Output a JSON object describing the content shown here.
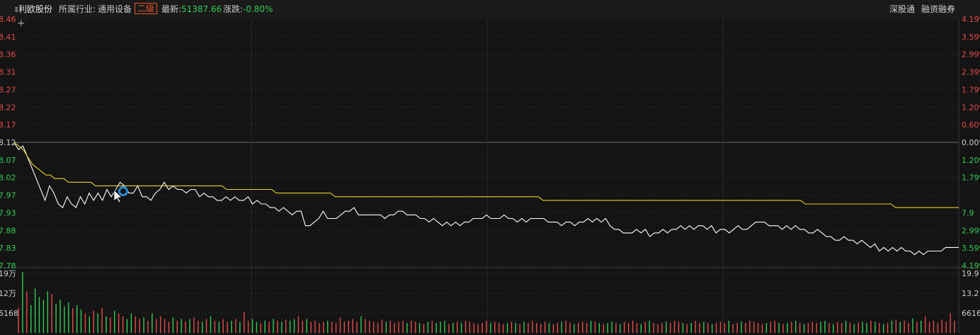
{
  "header": {
    "stock_name": "利欧股份",
    "industry_label": "所属行业:",
    "industry_value": "通用设备",
    "level_badge": "二级",
    "latest_label": "最新:",
    "latest_value": "51387.66",
    "change_label": "涨跌:",
    "change_value": "-0.80%",
    "link_shenguton": "深股通",
    "link_margin": "融资融券"
  },
  "colors": {
    "background": "#141414",
    "up": "#e84a4a",
    "down": "#33cc55",
    "price_line": "#ffffff",
    "avg_line": "#e6d22a",
    "grid": "#2e2e2e"
  },
  "chart_data": [
    {
      "type": "line",
      "prev_close": 8.12,
      "ylim": [
        7.78,
        8.46
      ],
      "y_tick_labels_left": [
        "8.46",
        "8.41",
        "8.36",
        "8.31",
        "8.27",
        "8.22",
        "8.17",
        "8.12",
        "8.07",
        "8.02",
        "7.97",
        "7.93",
        "7.88",
        "7.83",
        "7.78"
      ],
      "y_tick_labels_right": [
        "4.19%",
        "3.59%",
        "2.99%",
        "2.39%",
        "1.79%",
        "1.20%",
        "0.60%",
        "0.00%",
        "1.20%",
        "1.79%",
        "7.9",
        "2.99%",
        "3.59%",
        "4.19%"
      ],
      "series": [
        {
          "values": [
            8.12,
            8.1,
            8.11,
            8.08,
            8.05,
            8.02,
            7.99,
            7.96,
            8.0,
            7.98,
            7.95,
            7.94,
            7.97,
            7.95,
            7.94,
            7.97,
            7.95,
            7.98,
            7.96,
            7.98,
            7.96,
            7.99,
            7.97,
            7.99,
            8.01,
            8.0,
            7.98,
            7.98,
            8.0,
            7.97,
            7.97,
            7.96,
            7.98,
            7.99,
            8.01,
            7.99,
            8.0,
            7.99,
            7.99,
            7.98,
            7.99,
            7.99,
            7.97,
            7.98,
            7.97,
            7.97,
            7.96,
            7.96,
            7.97,
            7.96,
            7.97,
            7.96,
            7.96,
            7.97,
            7.95,
            7.96,
            7.95,
            7.95,
            7.94,
            7.94,
            7.93,
            7.94,
            7.93,
            7.92,
            7.93,
            7.93,
            7.89,
            7.89,
            7.9,
            7.91,
            7.93,
            7.91,
            7.91,
            7.91,
            7.92,
            7.93,
            7.93,
            7.94,
            7.92,
            7.92,
            7.92,
            7.92,
            7.92,
            7.92,
            7.91,
            7.92,
            7.92,
            7.93,
            7.93,
            7.92,
            7.92,
            7.92,
            7.91,
            7.91,
            7.9,
            7.91,
            7.9,
            7.89,
            7.9,
            7.89,
            7.9,
            7.89,
            7.9,
            7.9,
            7.91,
            7.91,
            7.91,
            7.92,
            7.91,
            7.91,
            7.91,
            7.92,
            7.91,
            7.91,
            7.9,
            7.91,
            7.9,
            7.91,
            7.91,
            7.91,
            7.91,
            7.9,
            7.9,
            7.9,
            7.89,
            7.9,
            7.9,
            7.89,
            7.9,
            7.9,
            7.91,
            7.9,
            7.91,
            7.9,
            7.91,
            7.89,
            7.88,
            7.88,
            7.87,
            7.87,
            7.87,
            7.88,
            7.87,
            7.88,
            7.86,
            7.87,
            7.87,
            7.88,
            7.87,
            7.88,
            7.88,
            7.89,
            7.88,
            7.89,
            7.88,
            7.89,
            7.89,
            7.88,
            7.89,
            7.87,
            7.88,
            7.88,
            7.87,
            7.88,
            7.89,
            7.88,
            7.88,
            7.89,
            7.9,
            7.9,
            7.9,
            7.89,
            7.89,
            7.89,
            7.88,
            7.89,
            7.88,
            7.89,
            7.88,
            7.88,
            7.87,
            7.87,
            7.88,
            7.87,
            7.86,
            7.86,
            7.85,
            7.85,
            7.86,
            7.85,
            7.85,
            7.84,
            7.85,
            7.84,
            7.83,
            7.84,
            7.82,
            7.83,
            7.82,
            7.83,
            7.82,
            7.83,
            7.82,
            7.82,
            7.81,
            7.82,
            7.81,
            7.82,
            7.82,
            7.82,
            7.82,
            7.83,
            7.83,
            7.83,
            7.83
          ]
        },
        {
          "values": [
            8.12,
            8.11,
            8.1,
            8.08,
            8.06,
            8.05,
            8.04,
            8.03,
            8.03,
            8.02,
            8.02,
            8.02,
            8.01,
            8.01,
            8.01,
            8.01,
            8.01,
            8.01,
            8.0,
            8.0,
            8.0,
            8.0,
            8.0,
            8.0,
            8.0,
            8.0,
            8.0,
            8.0,
            8.0,
            8.0,
            8.0,
            8.0,
            8.0,
            8.0,
            8.0,
            8.0,
            8.0,
            8.0,
            8.0,
            8.0,
            8.0,
            8.0,
            8.0,
            8.0,
            8.0,
            8.0,
            8.0,
            7.99,
            7.99,
            7.99,
            7.99,
            7.99,
            7.99,
            7.99,
            7.99,
            7.99,
            7.99,
            7.99,
            7.98,
            7.98,
            7.98,
            7.98,
            7.98,
            7.98,
            7.98,
            7.98,
            7.98,
            7.98,
            7.98,
            7.98,
            7.98,
            7.97,
            7.97,
            7.97,
            7.97,
            7.97,
            7.97,
            7.97,
            7.97,
            7.97,
            7.97,
            7.97,
            7.97,
            7.97,
            7.97,
            7.97,
            7.97,
            7.97,
            7.97,
            7.97,
            7.97,
            7.97,
            7.97,
            7.97,
            7.97,
            7.97,
            7.97,
            7.97,
            7.97,
            7.97,
            7.97,
            7.97,
            7.97,
            7.97,
            7.97,
            7.97,
            7.97,
            7.97,
            7.97,
            7.97,
            7.97,
            7.97,
            7.97,
            7.97,
            7.97,
            7.97,
            7.97,
            7.96,
            7.96,
            7.96,
            7.96,
            7.96,
            7.96,
            7.96,
            7.96,
            7.96,
            7.96,
            7.96,
            7.96,
            7.96,
            7.96,
            7.96,
            7.96,
            7.96,
            7.96,
            7.96,
            7.96,
            7.96,
            7.96,
            7.96,
            7.96,
            7.96,
            7.96,
            7.96,
            7.96,
            7.96,
            7.96,
            7.96,
            7.96,
            7.96,
            7.96,
            7.96,
            7.96,
            7.96,
            7.96,
            7.96,
            7.96,
            7.96,
            7.96,
            7.96,
            7.96,
            7.96,
            7.96,
            7.96,
            7.96,
            7.96,
            7.96,
            7.96,
            7.96,
            7.96,
            7.96,
            7.96,
            7.96,
            7.96,
            7.96,
            7.95,
            7.95,
            7.95,
            7.95,
            7.95,
            7.95,
            7.95,
            7.95,
            7.95,
            7.95,
            7.95,
            7.95,
            7.95,
            7.95,
            7.95,
            7.95,
            7.95,
            7.95,
            7.95,
            7.95,
            7.94,
            7.94,
            7.94,
            7.94,
            7.94,
            7.94,
            7.94,
            7.94,
            7.94,
            7.94,
            7.94,
            7.94,
            7.94,
            7.94,
            7.94
          ]
        }
      ]
    },
    {
      "type": "bar",
      "y_tick_labels_left": [
        "19万",
        "12万",
        "6168"
      ],
      "y_tick_labels_right": [
        "19.97",
        "13.27",
        "6616"
      ],
      "series": [
        {
          "values": [
            45,
            110,
            75,
            50,
            80,
            65,
            60,
            75,
            70,
            52,
            60,
            48,
            55,
            45,
            50,
            42,
            35,
            30,
            40,
            35,
            45,
            30,
            28,
            40,
            35,
            30,
            25,
            35,
            30,
            25,
            28,
            22,
            35,
            25,
            30,
            25,
            20,
            28,
            22,
            25,
            20,
            25,
            28,
            22,
            20,
            25,
            30,
            22,
            20,
            25,
            20,
            22,
            25,
            20,
            38,
            22,
            25,
            20,
            18,
            22,
            20,
            25,
            22,
            20,
            24,
            22,
            25,
            30,
            22,
            25,
            20,
            22,
            18,
            20,
            22,
            20,
            18,
            28,
            20,
            22,
            25,
            20,
            30,
            25,
            22,
            20,
            18,
            24,
            20,
            22,
            18,
            20,
            22,
            18,
            22,
            20,
            18,
            16,
            20,
            22,
            18,
            20,
            22,
            16,
            18,
            20,
            18,
            22,
            20,
            18,
            16,
            18,
            22,
            18,
            20,
            18,
            16,
            18,
            20,
            18,
            16,
            20,
            18,
            22,
            18,
            16,
            20,
            18,
            16,
            18,
            20,
            22,
            18,
            16,
            18,
            20,
            18,
            22,
            20,
            18,
            16,
            18,
            20,
            18,
            16,
            20,
            18,
            22,
            18,
            16,
            20,
            22,
            18,
            16,
            18,
            20,
            18,
            22,
            20,
            18,
            16,
            18,
            22,
            18,
            20,
            18,
            16,
            18,
            20,
            18,
            22,
            16,
            18,
            20,
            18,
            22,
            20,
            18,
            16,
            18,
            20,
            22,
            18,
            16,
            18,
            20,
            22,
            18,
            16,
            18,
            20,
            18,
            20,
            22,
            18,
            16,
            20,
            18,
            22,
            18,
            16,
            18,
            20,
            18,
            22,
            20,
            18,
            16,
            18,
            22,
            24,
            20,
            22,
            18,
            26,
            20,
            22,
            30,
            20,
            22,
            18,
            24,
            20,
            35,
            22
          ]
        }
      ]
    }
  ]
}
